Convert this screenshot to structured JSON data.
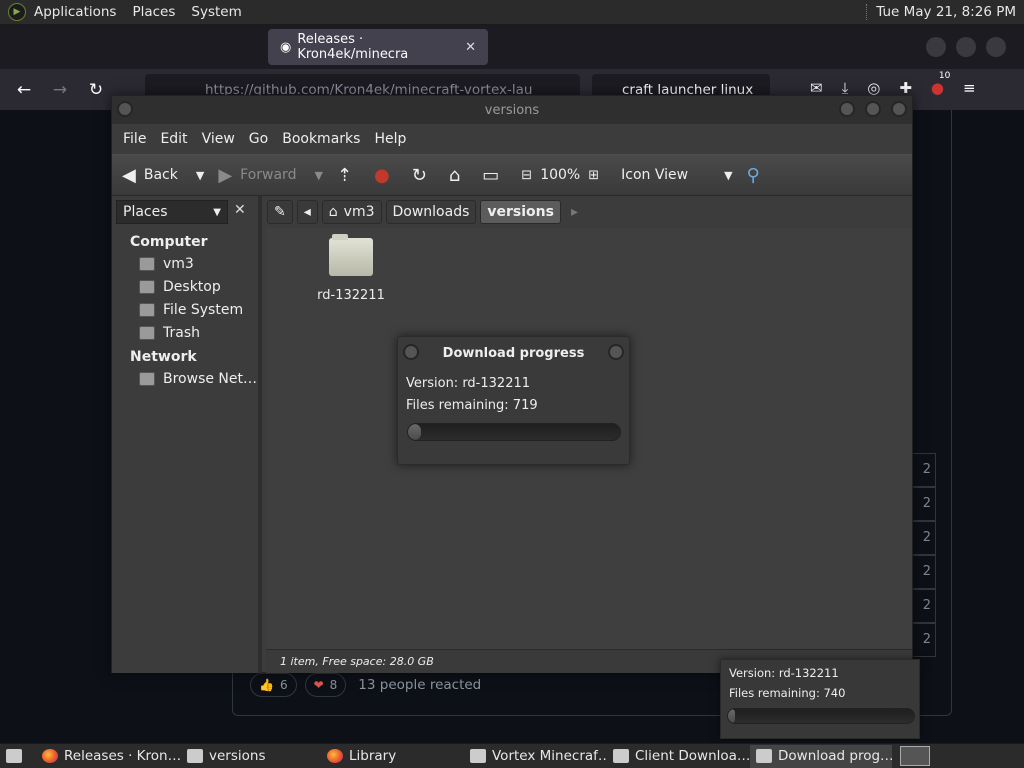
{
  "topbar": {
    "menus": [
      "Applications",
      "Places",
      "System"
    ],
    "clock": "Tue May 21, 8:26 PM"
  },
  "browser": {
    "tabs": [
      {
        "label": "",
        "active": false
      },
      {
        "label": "Releases · Kron4ek/minecra",
        "active": true
      }
    ],
    "url": "https://github.com/Kron4ek/minecraft-vortex-lau",
    "search": "craft launcher linux",
    "badge": "10"
  },
  "github": {
    "row_values": [
      "2",
      "2",
      "2",
      "2",
      "2",
      "2"
    ],
    "reactions": [
      {
        "icon": "👍",
        "count": "6"
      },
      {
        "icon": "❤",
        "count": "8"
      }
    ],
    "reacted_text": "13 people reacted"
  },
  "file_manager": {
    "title": "versions",
    "menus": [
      "File",
      "Edit",
      "View",
      "Go",
      "Bookmarks",
      "Help"
    ],
    "toolbar": {
      "back": "Back",
      "forward": "Forward",
      "zoom": "100%",
      "view_mode": "Icon View"
    },
    "path": [
      "vm3",
      "Downloads",
      "versions"
    ],
    "sidebar": {
      "selector": "Places",
      "sections": [
        {
          "title": "Computer",
          "items": [
            "vm3",
            "Desktop",
            "File System",
            "Trash"
          ]
        },
        {
          "title": "Network",
          "items": [
            "Browse Net…"
          ]
        }
      ]
    },
    "files": [
      {
        "name": "rd-132211",
        "type": "folder"
      }
    ],
    "status": "1 item, Free space: 28.0 GB"
  },
  "download_dialog": {
    "title": "Download progress",
    "version": "Version: rd-132211",
    "remaining": "Files remaining: 719",
    "progress": 0.03
  },
  "popup": {
    "version": "Version: rd-132211",
    "remaining": "Files remaining: 740",
    "progress": 0.02
  },
  "taskbar": {
    "items": [
      {
        "label": "Releases · Kron…",
        "icon": "firefox-icon"
      },
      {
        "label": "versions",
        "icon": "folder-icon"
      },
      {
        "label": "Library",
        "icon": "firefox-icon"
      },
      {
        "label": "Vortex Minecraf…",
        "icon": "window-icon"
      },
      {
        "label": "Client Downloa…",
        "icon": "window-icon"
      },
      {
        "label": "Download prog…",
        "icon": "window-icon"
      }
    ]
  }
}
